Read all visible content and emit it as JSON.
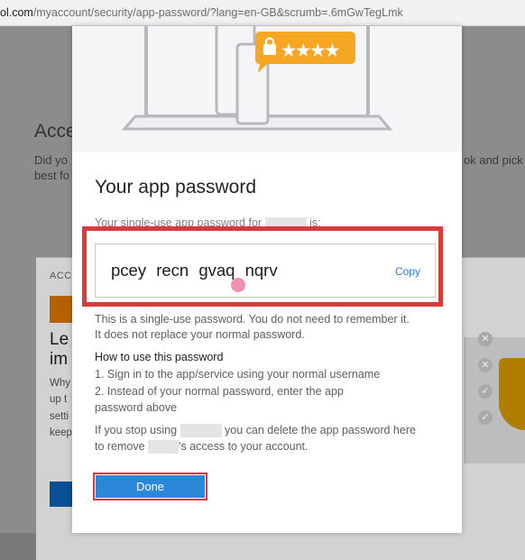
{
  "browser": {
    "url_host": "ol.com",
    "url_path": "/myaccount/security/app-password/?lang=en-GB&scrumb=.6mGwTegLmk"
  },
  "background": {
    "title": "Acce",
    "intro_line1_left": "Did yo",
    "intro_line1_right": "ok and pick s",
    "intro_line2": "best fo",
    "card_label": "ACC",
    "card_heading_1": "Le",
    "card_heading_2": "im",
    "card_text_lines": [
      "Why",
      "up t",
      "setti",
      "keep"
    ]
  },
  "modal": {
    "title": "Your app password",
    "subtitle_before": "Your single-use app password for",
    "subtitle_after": "is:",
    "password": "pcey recn gvaq nqrv",
    "copy_label": "Copy",
    "note_line1": "This is a single-use password. You do not need to remember it.",
    "note_line2": "It does not replace your normal password.",
    "how_title": "How to use this password",
    "step1": "1. Sign in to the app/service using your normal username",
    "step2_line1": "2. Instead of your normal password, enter the app",
    "step2_line2": "password above",
    "stop_before": "If you stop using",
    "stop_after": "you can delete the app password here",
    "remove_before": "to remove",
    "remove_after": "'s access to your account.",
    "done_label": "Done"
  },
  "colors": {
    "highlight_red": "#d93a3a",
    "primary_blue": "#2b87d8",
    "link_blue": "#2b7bd4",
    "badge_orange": "#f5a623"
  },
  "icons": [
    "lock-icon",
    "close-icon",
    "check-icon",
    "shield-icon"
  ]
}
